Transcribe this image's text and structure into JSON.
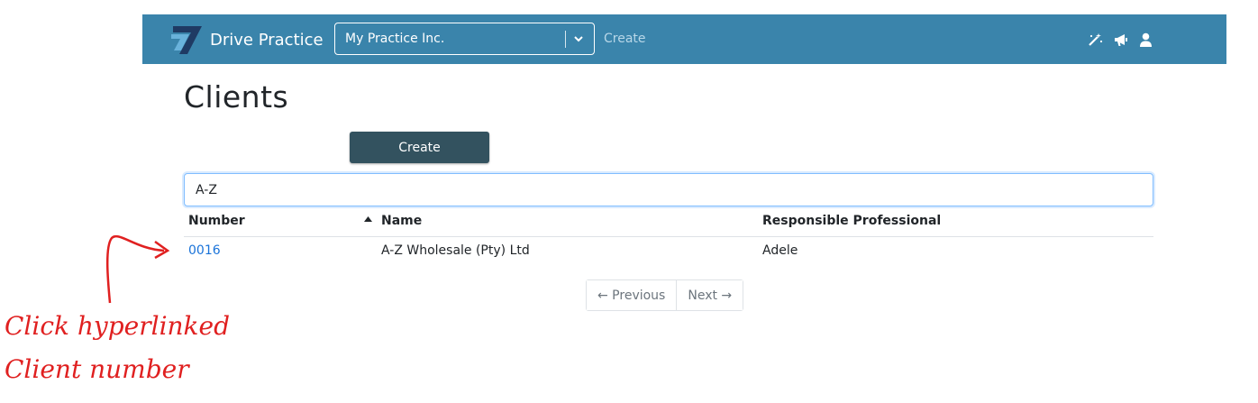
{
  "navbar": {
    "brand": "Drive Practice",
    "practice_select": {
      "value": "My Practice Inc."
    },
    "create_link": "Create",
    "icons": [
      "magic-wand-icon",
      "megaphone-icon",
      "user-icon"
    ],
    "bg_color": "#3a84ab"
  },
  "page": {
    "title": "Clients"
  },
  "toolbar": {
    "create_label": "Create"
  },
  "search": {
    "value": "A-Z"
  },
  "table": {
    "headers": [
      "Number",
      "Name",
      "Responsible Professional"
    ],
    "sorted_column": "Name",
    "rows": [
      {
        "number": "0016",
        "name": "A-Z Wholesale (Pty) Ltd",
        "responsible": "Adele"
      }
    ]
  },
  "pagination": {
    "previous": "← Previous",
    "next": "Next →"
  },
  "annotation": {
    "line1": "Click hyperlinked",
    "line2": "Client number",
    "color": "#e02020"
  }
}
